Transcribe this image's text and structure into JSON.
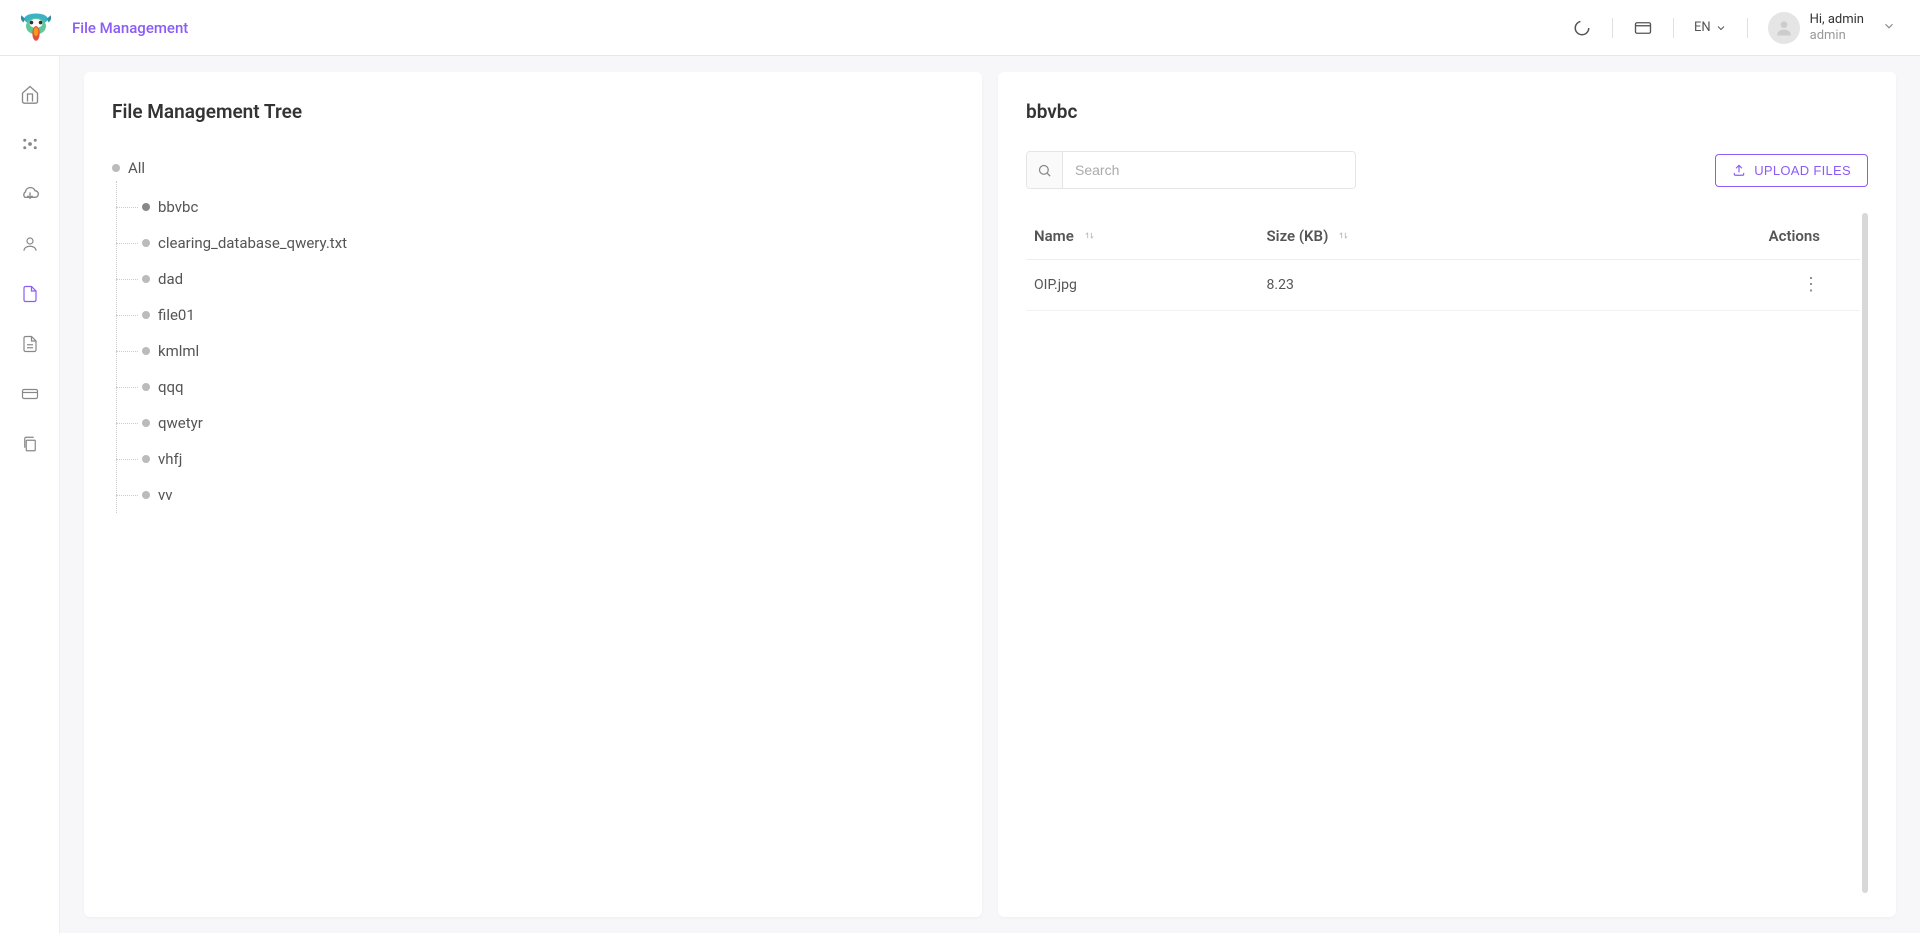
{
  "header": {
    "page_title": "File Management",
    "language": "EN",
    "user_greeting": "Hi, admin",
    "user_name": "admin"
  },
  "left_panel": {
    "title": "File Management Tree",
    "root_label": "All",
    "items": [
      {
        "label": "bbvbc",
        "selected": true
      },
      {
        "label": "clearing_database_qwery.txt",
        "selected": false
      },
      {
        "label": "dad",
        "selected": false
      },
      {
        "label": "file01",
        "selected": false
      },
      {
        "label": "kmlml",
        "selected": false
      },
      {
        "label": "qqq",
        "selected": false
      },
      {
        "label": "qwetyr",
        "selected": false
      },
      {
        "label": "vhfj",
        "selected": false
      },
      {
        "label": "vv",
        "selected": false
      }
    ]
  },
  "right_panel": {
    "title": "bbvbc",
    "search_placeholder": "Search",
    "upload_button": "UPLOAD FILES",
    "columns": {
      "name": "Name",
      "size": "Size (KB)",
      "actions": "Actions"
    },
    "rows": [
      {
        "name": "OIP.jpg",
        "size": "8.23"
      }
    ]
  }
}
